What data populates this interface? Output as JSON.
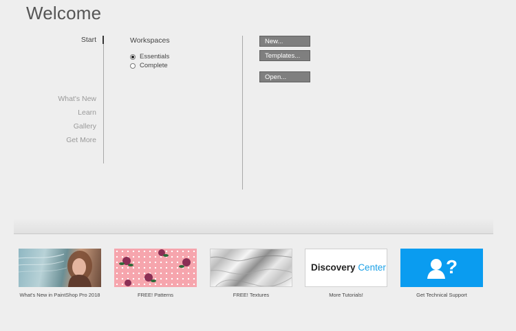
{
  "page": {
    "title": "Welcome"
  },
  "nav": {
    "items": [
      {
        "label": "Start",
        "active": true
      },
      {
        "label": "What's New",
        "active": false
      },
      {
        "label": "Learn",
        "active": false
      },
      {
        "label": "Gallery",
        "active": false
      },
      {
        "label": "Get More",
        "active": false
      }
    ]
  },
  "workspaces": {
    "title": "Workspaces",
    "options": [
      {
        "label": "Essentials",
        "selected": true
      },
      {
        "label": "Complete",
        "selected": false
      }
    ]
  },
  "actions": {
    "new_label": "New...",
    "templates_label": "Templates...",
    "open_label": "Open..."
  },
  "tiles": [
    {
      "caption": "What's New in PaintShop Pro 2018",
      "thumb": "portrait-photo"
    },
    {
      "caption": "FREE! Patterns",
      "thumb": "rose-pattern"
    },
    {
      "caption": "FREE! Textures",
      "thumb": "marble-texture"
    },
    {
      "caption": "More Tutorials!",
      "thumb": "discovery-center-logo",
      "logo_parts": [
        "Discovery",
        "Center",
        "™"
      ]
    },
    {
      "caption": "Get Technical Support",
      "thumb": "support-person-question-icon"
    }
  ],
  "colors": {
    "background": "#eeeeee",
    "button": "#7f7f7f",
    "support_tile": "#0a9cf0",
    "discovery_blue": "#1aa0e6",
    "pattern_pink": "#f6a5ad"
  }
}
